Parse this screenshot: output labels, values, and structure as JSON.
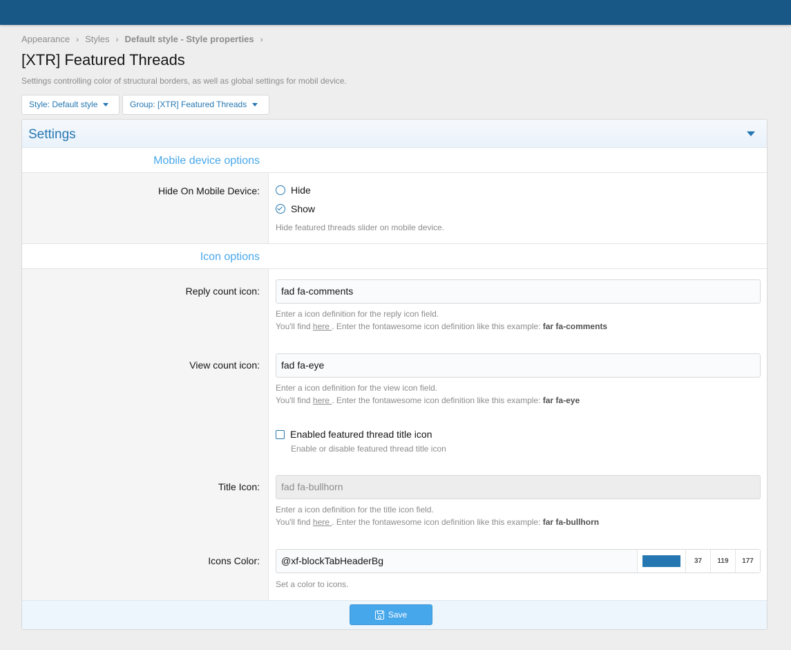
{
  "breadcrumb": {
    "items": [
      "Appearance",
      "Styles",
      "Default style - Style properties"
    ]
  },
  "page": {
    "title": "[XTR] Featured Threads",
    "description": "Settings controlling color of structural borders, as well as global settings for mobil device."
  },
  "filters": {
    "style_label": "Style: Default style",
    "group_label": "Group: [XTR] Featured Threads"
  },
  "block": {
    "header_title": "Settings"
  },
  "mobile_section": {
    "heading": "Mobile device options",
    "hide_label": "Hide On Mobile Device:",
    "option_hide": "Hide",
    "option_show": "Show",
    "selected": "Show",
    "explain": "Hide featured threads slider on mobile device."
  },
  "icon_section": {
    "heading": "Icon options",
    "reply": {
      "label": "Reply count icon:",
      "value": "fad fa-comments",
      "explain_line1": "Enter a icon definition for the reply icon field.",
      "explain_pre": "You'll find ",
      "explain_link": "here ",
      "explain_mid": ". Enter the fontawesome icon definition like this example: ",
      "explain_example": "far fa-comments"
    },
    "view": {
      "label": "View count icon:",
      "value": "fad fa-eye",
      "explain_line1": "Enter a icon definition for the view icon field.",
      "explain_pre": "You'll find ",
      "explain_link": "here ",
      "explain_mid": ". Enter the fontawesome icon definition like this example: ",
      "explain_example": "far fa-eye"
    },
    "title_toggle": {
      "label": "Enabled featured thread title icon",
      "hint": "Enable or disable featured thread title icon",
      "checked": false
    },
    "title_icon": {
      "label": "Title Icon:",
      "value": "fad fa-bullhorn",
      "explain_line1": "Enter a icon definition for the title icon field.",
      "explain_pre": "You'll find ",
      "explain_link": "here ",
      "explain_mid": ". Enter the fontawesome icon definition like this example: ",
      "explain_example": "far fa-bullhorn"
    },
    "color": {
      "label": "Icons Color:",
      "value": "@xf-blockTabHeaderBg",
      "swatch": "#2577b1",
      "r": "37",
      "g": "119",
      "b": "177",
      "explain": "Set a color to icons."
    }
  },
  "footer": {
    "save_label": "Save"
  },
  "colors": {
    "topbar": "#185886",
    "accent": "#2577b1",
    "button": "#47a7eb"
  }
}
